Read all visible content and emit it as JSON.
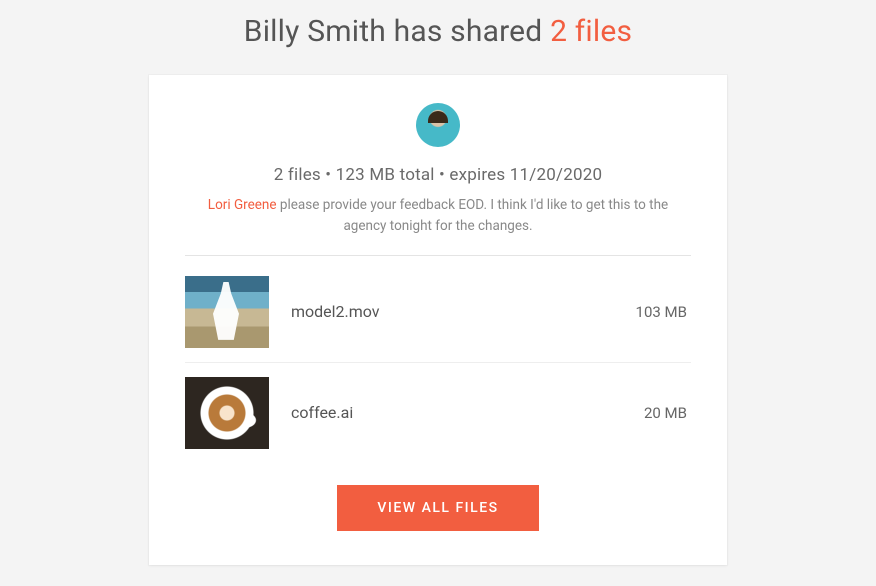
{
  "header": {
    "prefix": "Billy Smith has shared ",
    "accent": "2 files"
  },
  "colors": {
    "accent": "#f25e40"
  },
  "sharer": {
    "name": "Billy Smith"
  },
  "summary": {
    "file_count": "2 files",
    "sep1": " • ",
    "total_size": "123 MB total",
    "sep2": " • ",
    "expires": "expires 11/20/2020"
  },
  "message": {
    "mention": "Lori Greene",
    "text": " please provide your feedback EOD. I think I'd like to get this to the agency tonight for the changes."
  },
  "files": [
    {
      "name": "model2.mov",
      "size": "103 MB",
      "thumb": "model"
    },
    {
      "name": "coffee.ai",
      "size": "20 MB",
      "thumb": "coffee"
    }
  ],
  "cta": {
    "label": "VIEW ALL FILES"
  }
}
